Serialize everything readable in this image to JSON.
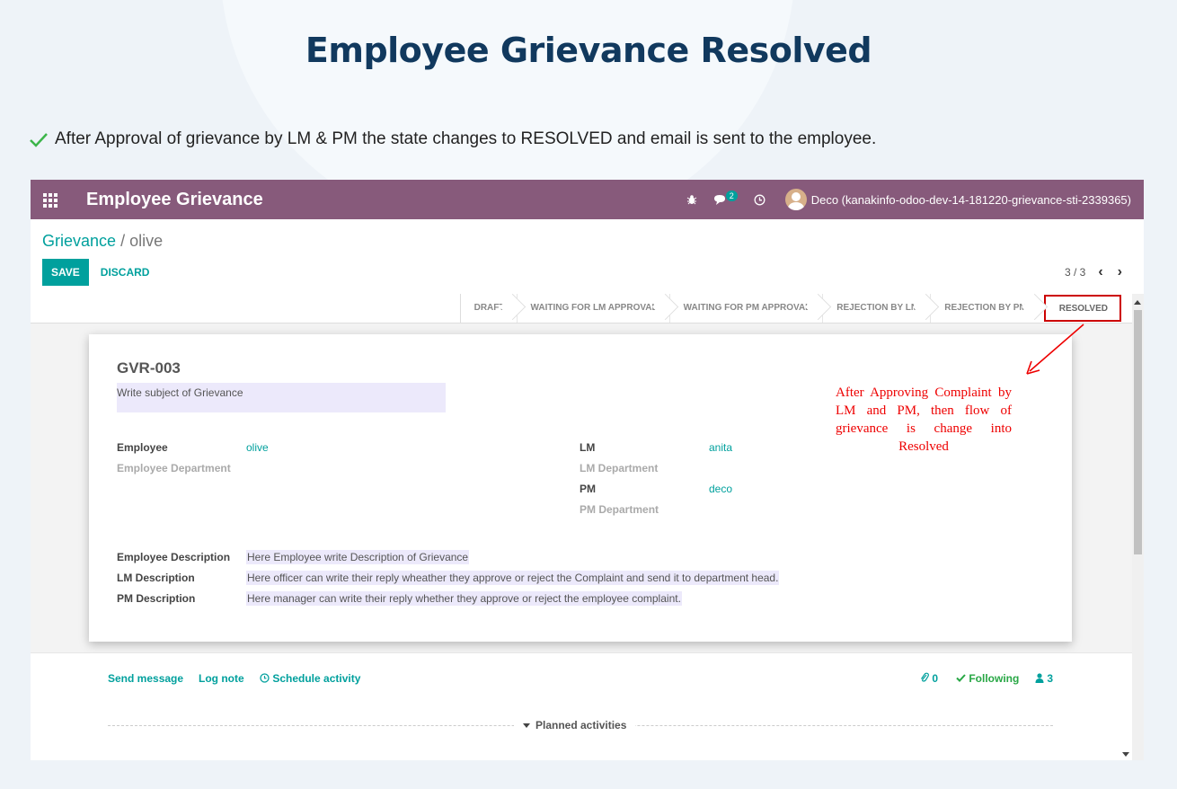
{
  "page": {
    "title": "Employee Grievance Resolved",
    "intro": "After Approval of grievance by LM & PM the state changes to RESOLVED and email is sent to the employee."
  },
  "navbar": {
    "app_title": "Employee Grievance",
    "messages_count": "2",
    "user_label": "Deco (kanakinfo-odoo-dev-14-181220-grievance-sti-2339365)"
  },
  "breadcrumb": {
    "parent": "Grievance",
    "separator": "/",
    "current": "olive"
  },
  "buttons": {
    "save": "SAVE",
    "discard": "DISCARD"
  },
  "pager": {
    "value": "3 / 3",
    "prev": "‹",
    "next": "›"
  },
  "status_stages": [
    "DRAFT",
    "WAITING FOR LM APPROVAL",
    "WAITING FOR PM APPROVAL",
    "REJECTION BY LM",
    "REJECTION BY PM",
    "RESOLVED"
  ],
  "active_stage": "RESOLVED",
  "form": {
    "reference": "GVR-003",
    "subject_placeholder": "Write subject of Grievance",
    "employee_label": "Employee",
    "employee_value": "olive",
    "employee_dept_label": "Employee Department",
    "lm_label": "LM",
    "lm_value": "anita",
    "lm_dept_label": "LM Department",
    "pm_label": "PM",
    "pm_value": "deco",
    "pm_dept_label": "PM Department",
    "emp_desc_label": "Employee Description",
    "emp_desc_value": "Here Employee write Description of Grievance",
    "lm_desc_label": "LM Description",
    "lm_desc_value": "Here officer can write their reply wheather they approve or reject the Complaint and send it to department head.",
    "pm_desc_label": "PM Description",
    "pm_desc_value": "Here manager can write their reply whether they approve or reject the employee complaint."
  },
  "annotation": "After Approving Complaint by LM and PM, then flow of grievance is change into Resolved",
  "chatter": {
    "send_message": "Send message",
    "log_note": "Log note",
    "schedule_activity": "Schedule activity",
    "attachments": "0",
    "following": "Following",
    "followers": "3",
    "planned_activities": "Planned activities"
  },
  "colors": {
    "brand": "#875a7b",
    "accent": "#00a09d",
    "title": "#11395e",
    "annotation": "#e00000"
  }
}
